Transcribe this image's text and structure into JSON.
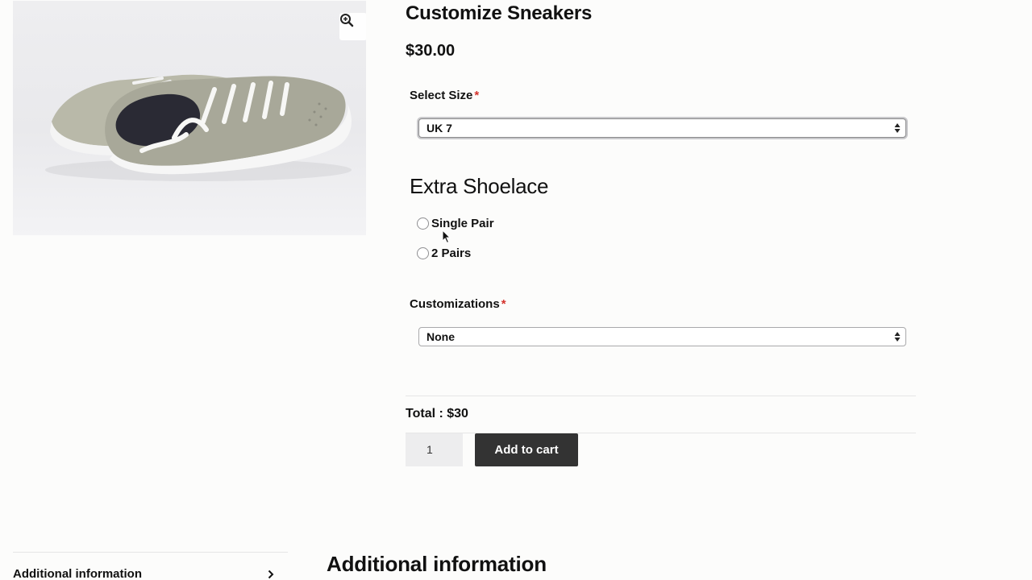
{
  "product": {
    "title": "Customize Sneakers",
    "price": "$30.00"
  },
  "image": {
    "alt": "Grey canvas sneakers with white laces",
    "zoom_icon": "magnifier-plus-icon"
  },
  "size_field": {
    "label": "Select Size",
    "required_mark": "*",
    "selected": "UK 7"
  },
  "shoelace": {
    "heading": "Extra Shoelace",
    "options": [
      {
        "label": "Single Pair",
        "checked": false
      },
      {
        "label": "2 Pairs",
        "checked": false
      }
    ]
  },
  "customizations_field": {
    "label": "Customizations",
    "required_mark": "*",
    "selected": "None"
  },
  "cart": {
    "total": "Total : $30",
    "quantity": "1",
    "add_label": "Add to cart"
  },
  "tabs": {
    "items": [
      {
        "label": "Additional information"
      }
    ],
    "panel_title": "Additional information"
  },
  "colors": {
    "button_bg": "#333333",
    "required": "#d4322c",
    "qty_bg": "#ededee"
  }
}
